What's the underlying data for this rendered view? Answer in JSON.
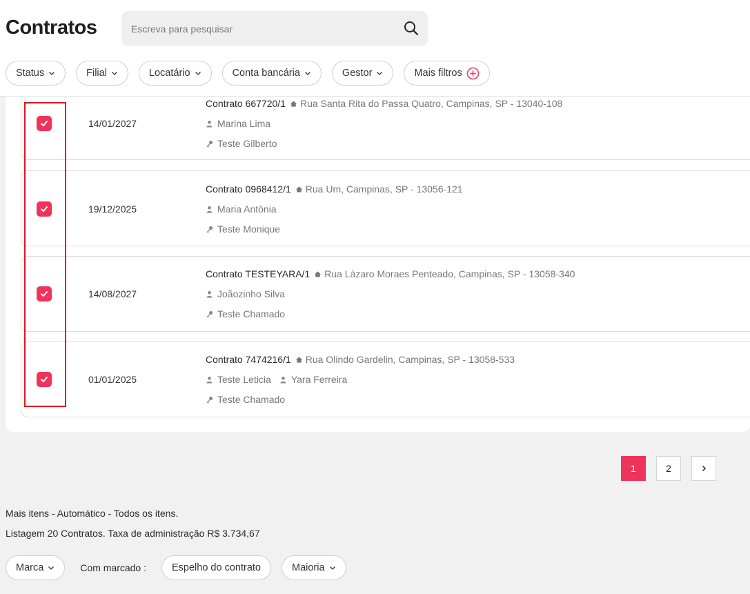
{
  "header": {
    "title": "Contratos",
    "search_placeholder": "Escreva para pesquisar"
  },
  "filters": [
    {
      "label": "Status"
    },
    {
      "label": "Filial"
    },
    {
      "label": "Locatário"
    },
    {
      "label": "Conta bancária"
    },
    {
      "label": "Gestor"
    }
  ],
  "more_filters_label": "Mais filtros",
  "contracts": [
    {
      "date": "14/01/2027",
      "contract": "Contrato 667720/1",
      "address": "Rua Santa Rita do Passa Quatro, Campinas, SP - 13040-108",
      "people": [
        "Marina Lima"
      ],
      "manager": "Teste Gilberto",
      "checked": true
    },
    {
      "date": "19/12/2025",
      "contract": "Contrato 0968412/1",
      "address": "Rua Um, Campinas, SP - 13056-121",
      "people": [
        "Maria Antônia"
      ],
      "manager": "Teste Monique",
      "checked": true
    },
    {
      "date": "14/08/2027",
      "contract": "Contrato TESTEYARA/1",
      "address": "Rua Lázaro Moraes Penteado, Campinas, SP - 13058-340",
      "people": [
        "Joãozinho Silva"
      ],
      "manager": "Teste Chamado",
      "checked": true
    },
    {
      "date": "01/01/2025",
      "contract": "Contrato 7474216/1",
      "address": "Rua Olindo Gardelin, Campinas, SP - 13058-533",
      "people": [
        "Teste Leticia",
        "Yara Ferreira"
      ],
      "manager": "Teste Chamado",
      "checked": true
    }
  ],
  "pagination": {
    "pages": [
      "1",
      "2"
    ],
    "current": "1",
    "next_icon": "chevron-right-icon"
  },
  "footer": {
    "more_items": "Mais itens - Automático - Todos os itens.",
    "listing": "Listagem 20 Contratos. Taxa de administração R$ 3.734,67",
    "mark_label": "Marca",
    "with_marked_label": "Com marcado :",
    "mirror_label": "Espelho do contrato",
    "majority_label": "Maioria"
  },
  "colors": {
    "accent": "#f0335a",
    "highlight_border": "#e3131b"
  }
}
